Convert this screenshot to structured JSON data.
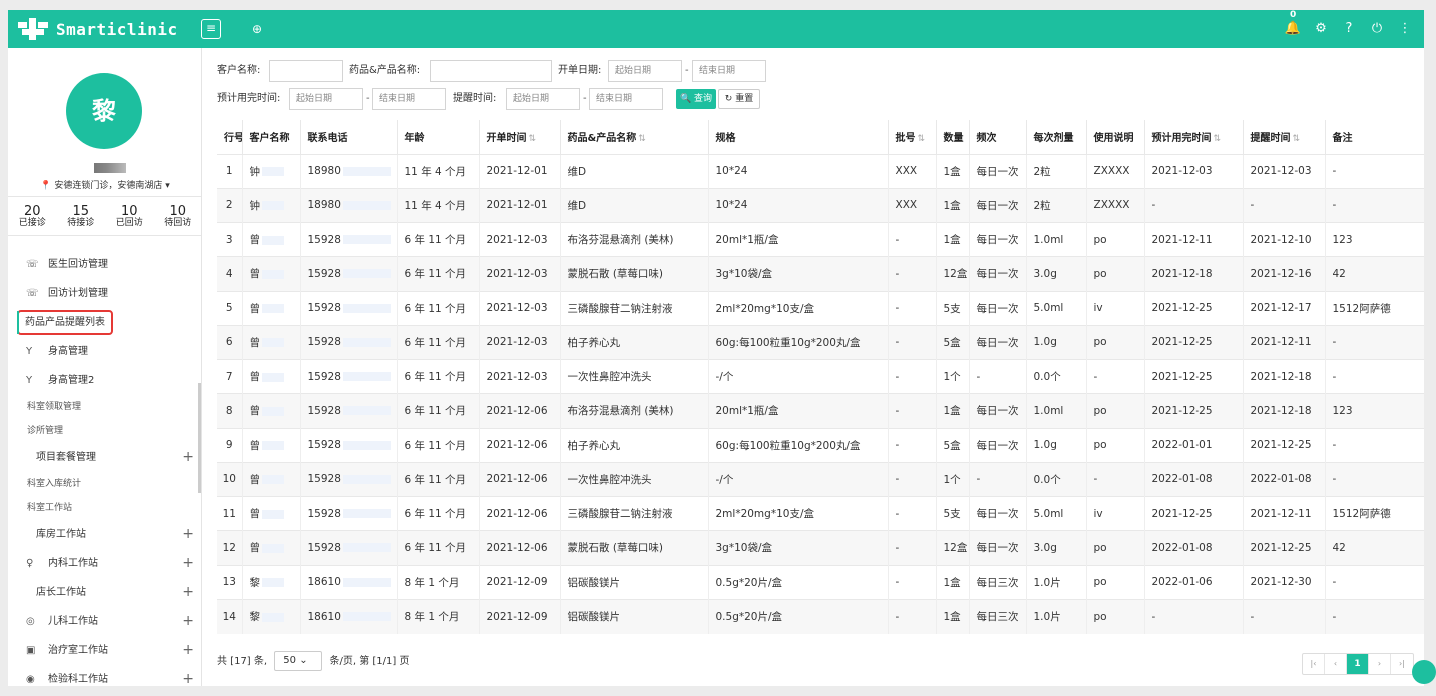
{
  "app": {
    "brand": "Smarticlinic",
    "menu_toggle": "≡",
    "add_tab": "⊕"
  },
  "topbar": {
    "notification_count": "0",
    "bell_icon": "🔔",
    "gear_icon": "⚙",
    "help_icon": "?",
    "power_icon": "⏻",
    "more_icon": "⋮"
  },
  "user": {
    "avatar_char": "黎",
    "store": "📍 安德连锁门诊，安德南湖店 ▾"
  },
  "stats": [
    {
      "value": "20",
      "label": "已接诊"
    },
    {
      "value": "15",
      "label": "待接诊"
    },
    {
      "value": "10",
      "label": "已回访"
    },
    {
      "value": "10",
      "label": "待回访"
    }
  ],
  "nav": [
    {
      "label": "医生回访管理",
      "icon": "☏",
      "kind": "item"
    },
    {
      "label": "回访计划管理",
      "icon": "☏",
      "kind": "item"
    },
    {
      "label": "药品产品提醒列表",
      "icon": "",
      "kind": "active"
    },
    {
      "label": "身高管理",
      "icon": "Y",
      "kind": "item"
    },
    {
      "label": "身高管理2",
      "icon": "Y",
      "kind": "item"
    },
    {
      "label": "科室领取管理",
      "icon": "",
      "kind": "sec"
    },
    {
      "label": "诊所管理",
      "icon": "",
      "kind": "sec"
    },
    {
      "label": "项目套餐管理",
      "icon": "",
      "kind": "sub",
      "plus": "+"
    },
    {
      "label": "科室入库统计",
      "icon": "",
      "kind": "sec"
    },
    {
      "label": "科室工作站",
      "icon": "",
      "kind": "sec"
    },
    {
      "label": "库房工作站",
      "icon": "",
      "kind": "sub",
      "plus": "+"
    },
    {
      "label": "内科工作站",
      "icon": "♀",
      "kind": "item",
      "plus": "+"
    },
    {
      "label": "店长工作站",
      "icon": "",
      "kind": "sub",
      "plus": "+"
    },
    {
      "label": "儿科工作站",
      "icon": "◎",
      "kind": "item",
      "plus": "+"
    },
    {
      "label": "治疗室工作站",
      "icon": "▣",
      "kind": "item",
      "plus": "+"
    },
    {
      "label": "检验科工作站",
      "icon": "◉",
      "kind": "item",
      "plus": "+"
    }
  ],
  "filters": {
    "customer_label": "客户名称:",
    "drug_label": "药品&产品名称:",
    "order_date_label": "开单日期:",
    "expected_end_label": "预计用完时间:",
    "remind_label": "提醒时间:",
    "start_ph": "起始日期",
    "end_ph": "结束日期",
    "dash": "-",
    "search_btn": "🔍 查询",
    "reset_btn": "↻ 重置"
  },
  "table": {
    "sort_icon": "⇅",
    "headers": [
      {
        "label": "行号",
        "sort": false
      },
      {
        "label": "客户名称",
        "sort": false
      },
      {
        "label": "联系电话",
        "sort": false
      },
      {
        "label": "年龄",
        "sort": false
      },
      {
        "label": "开单时间",
        "sort": true
      },
      {
        "label": "药品&产品名称",
        "sort": true
      },
      {
        "label": "规格",
        "sort": false
      },
      {
        "label": "批号",
        "sort": true
      },
      {
        "label": "数量",
        "sort": false
      },
      {
        "label": "频次",
        "sort": false
      },
      {
        "label": "每次剂量",
        "sort": false
      },
      {
        "label": "使用说明",
        "sort": false
      },
      {
        "label": "预计用完时间",
        "sort": true
      },
      {
        "label": "提醒时间",
        "sort": true
      },
      {
        "label": "备注",
        "sort": false
      }
    ],
    "rows": [
      [
        "1",
        "钟",
        "18980",
        "11 年 4 个月",
        "2021-12-01",
        "维D",
        "10*24",
        "XXX",
        "1盒",
        "每日一次",
        "2粒",
        "ZXXXX",
        "2021-12-03",
        "2021-12-03",
        "-"
      ],
      [
        "2",
        "钟",
        "18980",
        "11 年 4 个月",
        "2021-12-01",
        "维D",
        "10*24",
        "XXX",
        "1盒",
        "每日一次",
        "2粒",
        "ZXXXX",
        "-",
        "-",
        "-"
      ],
      [
        "3",
        "曾",
        "15928",
        "6 年 11 个月",
        "2021-12-03",
        "布洛芬混悬滴剂 (美林)",
        "20ml*1瓶/盒",
        "-",
        "1盒",
        "每日一次",
        "1.0ml",
        "po",
        "2021-12-11",
        "2021-12-10",
        "123"
      ],
      [
        "4",
        "曾",
        "15928",
        "6 年 11 个月",
        "2021-12-03",
        "蒙脱石散 (草莓口味)",
        "3g*10袋/盒",
        "-",
        "12盒",
        "每日一次",
        "3.0g",
        "po",
        "2021-12-18",
        "2021-12-16",
        "42"
      ],
      [
        "5",
        "曾",
        "15928",
        "6 年 11 个月",
        "2021-12-03",
        "三磷酸腺苷二钠注射液",
        "2ml*20mg*10支/盒",
        "-",
        "5支",
        "每日一次",
        "5.0ml",
        "iv",
        "2021-12-25",
        "2021-12-17",
        "1512阿萨德"
      ],
      [
        "6",
        "曾",
        "15928",
        "6 年 11 个月",
        "2021-12-03",
        "柏子养心丸",
        "60g:每100粒重10g*200丸/盒",
        "-",
        "5盒",
        "每日一次",
        "1.0g",
        "po",
        "2021-12-25",
        "2021-12-11",
        "-"
      ],
      [
        "7",
        "曾",
        "15928",
        "6 年 11 个月",
        "2021-12-03",
        "一次性鼻腔冲洗头",
        "-/个",
        "-",
        "1个",
        "-",
        "0.0个",
        "-",
        "2021-12-25",
        "2021-12-18",
        "-"
      ],
      [
        "8",
        "曾",
        "15928",
        "6 年 11 个月",
        "2021-12-06",
        "布洛芬混悬滴剂 (美林)",
        "20ml*1瓶/盒",
        "-",
        "1盒",
        "每日一次",
        "1.0ml",
        "po",
        "2021-12-25",
        "2021-12-18",
        "123"
      ],
      [
        "9",
        "曾",
        "15928",
        "6 年 11 个月",
        "2021-12-06",
        "柏子养心丸",
        "60g:每100粒重10g*200丸/盒",
        "-",
        "5盒",
        "每日一次",
        "1.0g",
        "po",
        "2022-01-01",
        "2021-12-25",
        "-"
      ],
      [
        "10",
        "曾",
        "15928",
        "6 年 11 个月",
        "2021-12-06",
        "一次性鼻腔冲洗头",
        "-/个",
        "-",
        "1个",
        "-",
        "0.0个",
        "-",
        "2022-01-08",
        "2022-01-08",
        "-"
      ],
      [
        "11",
        "曾",
        "15928",
        "6 年 11 个月",
        "2021-12-06",
        "三磷酸腺苷二钠注射液",
        "2ml*20mg*10支/盒",
        "-",
        "5支",
        "每日一次",
        "5.0ml",
        "iv",
        "2021-12-25",
        "2021-12-11",
        "1512阿萨德"
      ],
      [
        "12",
        "曾",
        "15928",
        "6 年 11 个月",
        "2021-12-06",
        "蒙脱石散 (草莓口味)",
        "3g*10袋/盒",
        "-",
        "12盒",
        "每日一次",
        "3.0g",
        "po",
        "2022-01-08",
        "2021-12-25",
        "42"
      ],
      [
        "13",
        "黎",
        "18610",
        "8 年 1 个月",
        "2021-12-09",
        "铝碳酸镁片",
        "0.5g*20片/盒",
        "-",
        "1盒",
        "每日三次",
        "1.0片",
        "po",
        "2022-01-06",
        "2021-12-30",
        "-"
      ],
      [
        "14",
        "黎",
        "18610",
        "8 年 1 个月",
        "2021-12-09",
        "铝碳酸镁片",
        "0.5g*20片/盒",
        "-",
        "1盒",
        "每日三次",
        "1.0片",
        "po",
        "-",
        "-",
        "-"
      ]
    ]
  },
  "footer": {
    "total": "共 [17] 条,",
    "page_size": "50",
    "per_page": "条/页,",
    "page_info": "第 [1/1] 页",
    "first": "|‹",
    "prev": "‹",
    "current": "1",
    "next": "›",
    "last": "›|"
  },
  "colors": {
    "accent": "#1dbf9f",
    "highlight": "#e53935"
  }
}
